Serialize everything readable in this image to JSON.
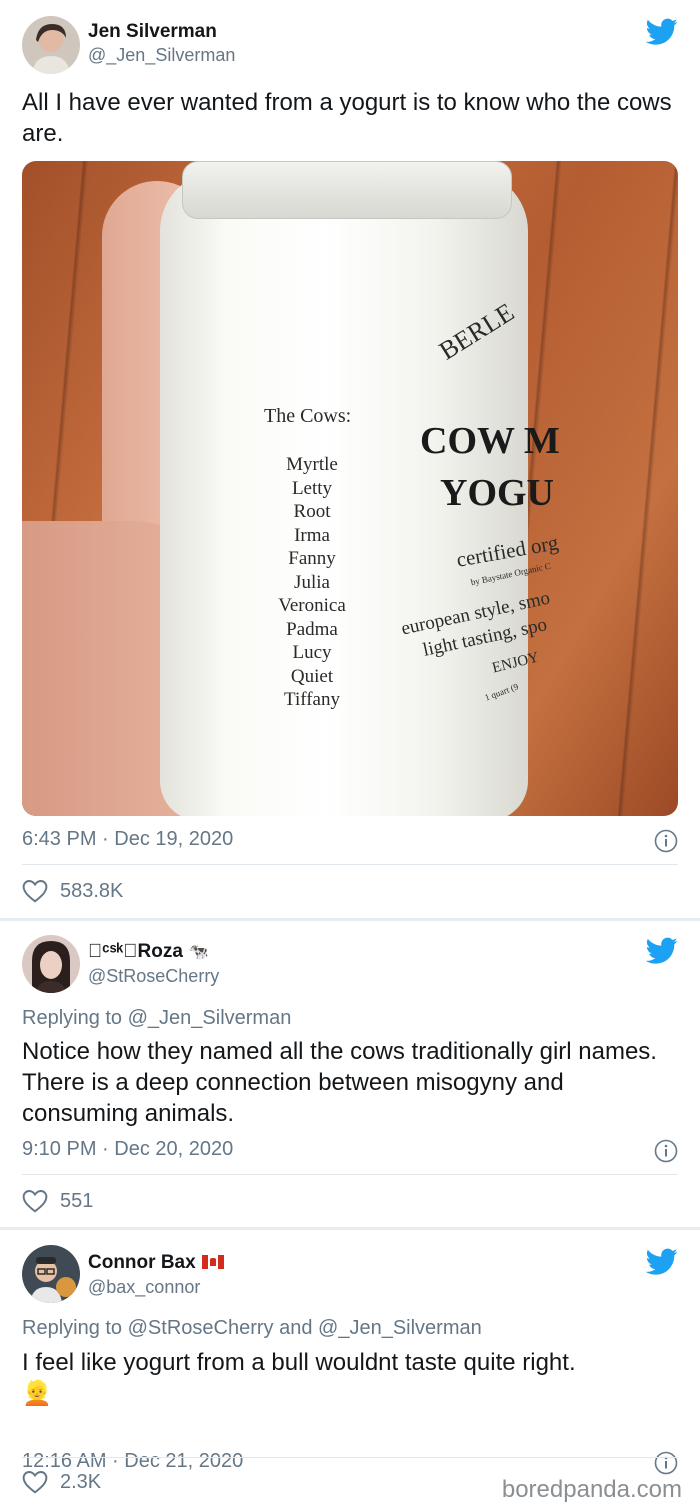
{
  "tweets": [
    {
      "author": "Jen Silverman",
      "handle": "@_Jen_Silverman",
      "text": "All I have ever wanted from a yogurt is to know who the cows are.",
      "photo": {
        "cows_title": "The Cows:",
        "cows": [
          "Myrtle",
          "Letty",
          "Root",
          "Irma",
          "Fanny",
          "Julia",
          "Veronica",
          "Padma",
          "Lucy",
          "Quiet",
          "Tiffany"
        ],
        "brand": "BERLE",
        "product_line1": "COW M",
        "product_line2": "YOGU",
        "certified": "certified org",
        "by_line": "by Baystate Organic C",
        "desc1": "european style, smo",
        "desc2": "light tasting, spo",
        "enjoy": "ENJOY",
        "quantity": "1 quart (9"
      },
      "timestamp": "6:43 PM · Dec 19, 2020",
      "likes": "583.8K"
    },
    {
      "author": "\u0000ᶜˢᵏ\u0000Roza",
      "author_display": "􀀀ᶜˢᵏ􀀀Roza",
      "author_emoji": "🐄",
      "handle": "@StRoseCherry",
      "replying_label": "Replying to",
      "replying_to": "@_Jen_Silverman",
      "text": "Notice how they named all the cows traditionally girl names. There is a deep connection between misogyny and consuming animals.",
      "timestamp": "9:10 PM · Dec 20, 2020",
      "likes": "551"
    },
    {
      "author": "Connor Bax",
      "handle": "@bax_connor",
      "replying_label": "Replying to",
      "replying_to": "@StRoseCherry",
      "replying_and": "and",
      "replying_to_2": "@_Jen_Silverman",
      "text": "I feel like yogurt from a bull wouldnt taste quite right.",
      "emoji": "👱",
      "timestamp": "12:16 AM · Dec 21, 2020",
      "likes": "2.3K"
    }
  ],
  "watermark": "boredpanda.com",
  "colors": {
    "twitter_blue": "#1da1f2",
    "text_gray": "#657786",
    "divider": "#e1e8ed"
  },
  "icons": [
    "twitter-bird-icon",
    "info-icon",
    "heart-icon"
  ]
}
